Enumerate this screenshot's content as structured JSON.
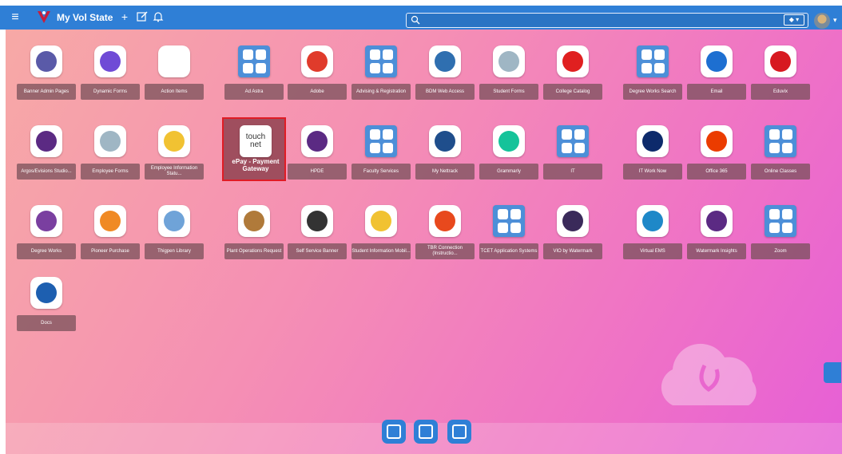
{
  "header": {
    "title": "My Vol State",
    "search": {
      "value": "",
      "placeholder": ""
    },
    "accent": "#2f7fd6"
  },
  "apps": [
    {
      "label": "Banner Admin Pages",
      "color": "#5a5aa8",
      "icon": "banner-icon"
    },
    {
      "label": "Dynamic Forms",
      "color": "#6f4bd6",
      "icon": "forms-icon"
    },
    {
      "label": "Action Items",
      "color": "#ffffff",
      "icon": "checklist-icon"
    },
    {
      "label": "Ad Astra",
      "color": "#4d8fd8",
      "icon": "folder-icon"
    },
    {
      "label": "Adobe",
      "color": "#e03b2b",
      "icon": "adobe-icon"
    },
    {
      "label": "Advising & Registration",
      "color": "#4d8fd8",
      "icon": "folder-icon"
    },
    {
      "label": "BDM Web Access",
      "color": "#2f6fb0",
      "icon": "bdm-icon"
    },
    {
      "label": "Student Forms",
      "color": "#9fb6c4",
      "icon": "forms-icon"
    },
    {
      "label": "College Catalog",
      "color": "#e02020",
      "icon": "catalog-icon"
    },
    {
      "label": "Degree Works Search",
      "color": "#4d8fd8",
      "icon": "folder-icon"
    },
    {
      "label": "Email",
      "color": "#1d6fd1",
      "icon": "outlook-icon"
    },
    {
      "label": "Eduvix",
      "color": "#d71920",
      "icon": "tn-icon"
    },
    {
      "label": "Argos/Evisions Studio...",
      "color": "#5b2a83",
      "icon": "argos-icon"
    },
    {
      "label": "Employee Forms",
      "color": "#9fb6c4",
      "icon": "forms-icon"
    },
    {
      "label": "Employee Information Statu...",
      "color": "#f1c232",
      "icon": "info-icon"
    },
    {
      "label": "ePay - Payment Gateway",
      "color": "#ffffff",
      "icon": "touchnet-icon",
      "selected": true
    },
    {
      "label": "HPDE",
      "color": "#5b2a83",
      "icon": "argos-icon"
    },
    {
      "label": "Faculty Services",
      "color": "#4d8fd8",
      "icon": "folder-icon"
    },
    {
      "label": "My Nettrack",
      "color": "#1f4e8c",
      "icon": "shield-icon"
    },
    {
      "label": "Grammarly",
      "color": "#15c39a",
      "icon": "grammarly-icon"
    },
    {
      "label": "IT",
      "color": "#4d8fd8",
      "icon": "folder-icon"
    },
    {
      "label": "IT Work Now",
      "color": "#0d2a6b",
      "icon": "fish-icon"
    },
    {
      "label": "Office 365",
      "color": "#eb3c00",
      "icon": "office-icon"
    },
    {
      "label": "Online Classes",
      "color": "#4d8fd8",
      "icon": "folder-icon"
    },
    {
      "label": "Degree Works",
      "color": "#7a3fa0",
      "icon": "graduate-icon"
    },
    {
      "label": "Pioneer Purchase",
      "color": "#f08a24",
      "icon": "cart-icon"
    },
    {
      "label": "Thigpen Library",
      "color": "#6fa3d8",
      "icon": "library-icon"
    },
    {
      "label": "Plant Operations Request",
      "color": "#b07a3a",
      "icon": "plant-icon"
    },
    {
      "label": "Self Service Banner",
      "color": "#333333",
      "icon": "banner-icon"
    },
    {
      "label": "Student Information Mobil...",
      "color": "#f1c232",
      "icon": "info-icon"
    },
    {
      "label": "TBR Connection (Instructio...",
      "color": "#e8491d",
      "icon": "tbr-icon"
    },
    {
      "label": "TCET Application Systems",
      "color": "#4d8fd8",
      "icon": "folder-icon"
    },
    {
      "label": "VIO by Watermark",
      "color": "#3a2a5a",
      "icon": "vio-icon"
    },
    {
      "label": "Virtual EMS",
      "color": "#1e88c8",
      "icon": "ems-icon"
    },
    {
      "label": "Watermark Insights",
      "color": "#5b2a83",
      "icon": "watermark-icon"
    },
    {
      "label": "Zoom",
      "color": "#4d8fd8",
      "icon": "folder-icon"
    },
    {
      "label": "Docs",
      "color": "#1d5fb0",
      "icon": "state-icon"
    }
  ],
  "dock": [
    {
      "icon": "folder-open-icon"
    },
    {
      "icon": "apps-icon"
    },
    {
      "icon": "note-icon"
    }
  ]
}
